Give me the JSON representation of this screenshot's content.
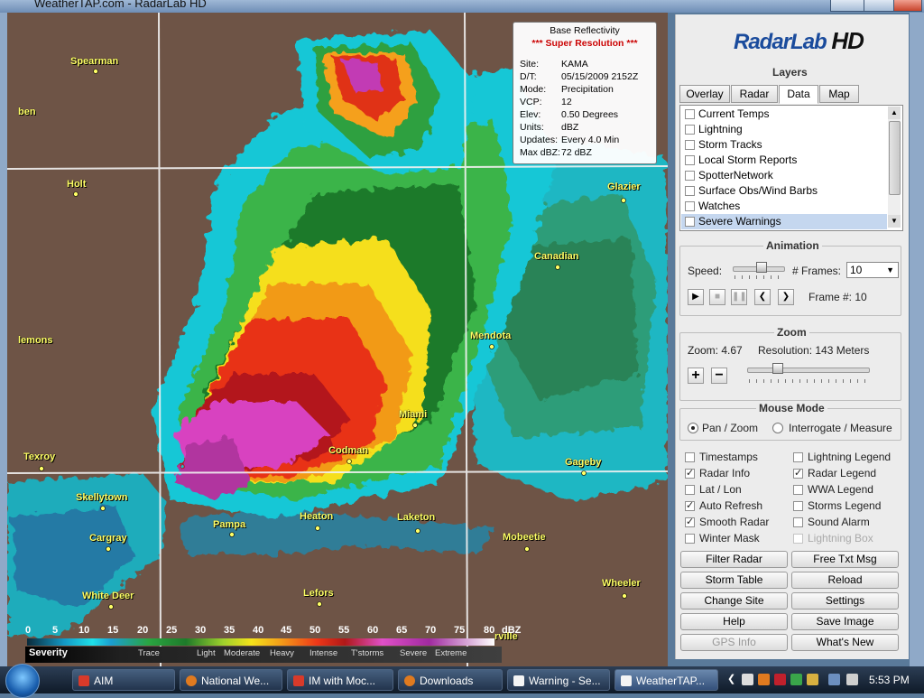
{
  "window": {
    "title": "WeatherTAP.com - RadarLab HD"
  },
  "map": {
    "cities": [
      {
        "name": "Spearman"
      },
      {
        "name": "ben"
      },
      {
        "name": "Holt"
      },
      {
        "name": "Glazier"
      },
      {
        "name": "Canadian"
      },
      {
        "name": "lemons"
      },
      {
        "name": "Mendota"
      },
      {
        "name": "Miami"
      },
      {
        "name": "Codman"
      },
      {
        "name": "Texroy"
      },
      {
        "name": "Gageby"
      },
      {
        "name": "Skellytown"
      },
      {
        "name": "Pampa"
      },
      {
        "name": "Heaton"
      },
      {
        "name": "Laketon"
      },
      {
        "name": "Cargray"
      },
      {
        "name": "Mobeetie"
      },
      {
        "name": "White Deer"
      },
      {
        "name": "Wheeler"
      },
      {
        "name": "Lefors"
      },
      {
        "name": "rville"
      }
    ],
    "info": {
      "header": "Base Reflectivity",
      "super_res": "*** Super Resolution ***",
      "rows": [
        {
          "key": "Site:",
          "value": "KAMA"
        },
        {
          "key": "D/T:",
          "value": "05/15/2009 2152Z"
        },
        {
          "key": "Mode:",
          "value": "Precipitation"
        },
        {
          "key": "VCP:",
          "value": "12"
        },
        {
          "key": "Elev:",
          "value": "0.50 Degrees"
        },
        {
          "key": "Units:",
          "value": "dBZ"
        },
        {
          "key": "Updates:",
          "value": "Every 4.0 Min"
        },
        {
          "key": "Max dBZ:",
          "value": "72 dBZ"
        }
      ]
    },
    "legend": {
      "values": [
        "0",
        "5",
        "10",
        "15",
        "20",
        "25",
        "30",
        "35",
        "40",
        "45",
        "50",
        "55",
        "60",
        "65",
        "70",
        "75",
        "80"
      ],
      "unit": "dBZ",
      "severity_label": "Severity",
      "severity_levels": [
        "Trace",
        "Light",
        "Moderate",
        "Heavy",
        "Intense",
        "T'storms",
        "Severe",
        "Extreme"
      ]
    }
  },
  "panel": {
    "logo_main": "RadarLab",
    "logo_hd": "HD",
    "layers_title": "Layers",
    "tabs": [
      {
        "label": "Overlay",
        "active": false
      },
      {
        "label": "Radar",
        "active": false
      },
      {
        "label": "Data",
        "active": true
      },
      {
        "label": "Map",
        "active": false
      }
    ],
    "layers": [
      {
        "label": "Current Temps",
        "checked": false,
        "selected": false
      },
      {
        "label": "Lightning",
        "checked": false,
        "selected": false
      },
      {
        "label": "Storm Tracks",
        "checked": false,
        "selected": false
      },
      {
        "label": "Local Storm Reports",
        "checked": false,
        "selected": false
      },
      {
        "label": "SpotterNetwork",
        "checked": false,
        "selected": false
      },
      {
        "label": "Surface Obs/Wind Barbs",
        "checked": false,
        "selected": false
      },
      {
        "label": "Watches",
        "checked": false,
        "selected": false
      },
      {
        "label": "Severe Warnings",
        "checked": false,
        "selected": true
      }
    ],
    "animation": {
      "title": "Animation",
      "speed_label": "Speed:",
      "speed_level": 0.55,
      "frames_label": "# Frames:",
      "frames_value": "10",
      "frame_label": "Frame #: 10"
    },
    "zoom": {
      "title": "Zoom",
      "zoom_text": "Zoom:  4.67",
      "resolution_text": "Resolution:  143 Meters",
      "plus": "+",
      "minus": "−",
      "zoom_level": 0.25
    },
    "mouse_mode": {
      "title": "Mouse Mode",
      "options": [
        {
          "label": "Pan / Zoom",
          "selected": true
        },
        {
          "label": "Interrogate / Measure",
          "selected": false
        }
      ]
    },
    "options_left": [
      {
        "label": "Timestamps",
        "checked": false,
        "disabled": false
      },
      {
        "label": "Radar Info",
        "checked": true,
        "disabled": false
      },
      {
        "label": "Lat / Lon",
        "checked": false,
        "disabled": false
      },
      {
        "label": "Auto Refresh",
        "checked": true,
        "disabled": false
      },
      {
        "label": "Smooth Radar",
        "checked": true,
        "disabled": false
      },
      {
        "label": "Winter Mask",
        "checked": false,
        "disabled": false
      }
    ],
    "options_right": [
      {
        "label": "Lightning Legend",
        "checked": false,
        "disabled": false
      },
      {
        "label": "Radar Legend",
        "checked": true,
        "disabled": false
      },
      {
        "label": "WWA Legend",
        "checked": false,
        "disabled": false
      },
      {
        "label": "Storms Legend",
        "checked": false,
        "disabled": false
      },
      {
        "label": "Sound Alarm",
        "checked": false,
        "disabled": false
      },
      {
        "label": "Lightning Box",
        "checked": false,
        "disabled": true
      }
    ],
    "buttons": [
      {
        "label": "Filter Radar",
        "disabled": false
      },
      {
        "label": "Free Txt Msg",
        "disabled": false
      },
      {
        "label": "Storm Table",
        "disabled": false
      },
      {
        "label": "Reload",
        "disabled": false
      },
      {
        "label": "Change Site",
        "disabled": false
      },
      {
        "label": "Settings",
        "disabled": false
      },
      {
        "label": "Help",
        "disabled": false
      },
      {
        "label": "Save Image",
        "disabled": false
      },
      {
        "label": "GPS Info",
        "disabled": true
      },
      {
        "label": "What's New",
        "disabled": false
      }
    ]
  },
  "taskbar": {
    "tasks": [
      {
        "label": "AIM",
        "icon_color": "#d83a2a",
        "active": false
      },
      {
        "label": "National We...",
        "icon_color": "#e07a1f",
        "active": false
      },
      {
        "label": "IM with Moc...",
        "icon_color": "#d83a2a",
        "active": false
      },
      {
        "label": "Downloads",
        "icon_color": "#e07a1f",
        "active": false
      },
      {
        "label": "Warning - Se...",
        "icon_color": "#ffffff",
        "active": false
      },
      {
        "label": "WeatherTAP...",
        "icon_color": "#ffffff",
        "active": true
      }
    ],
    "clock": "5:53 PM"
  }
}
